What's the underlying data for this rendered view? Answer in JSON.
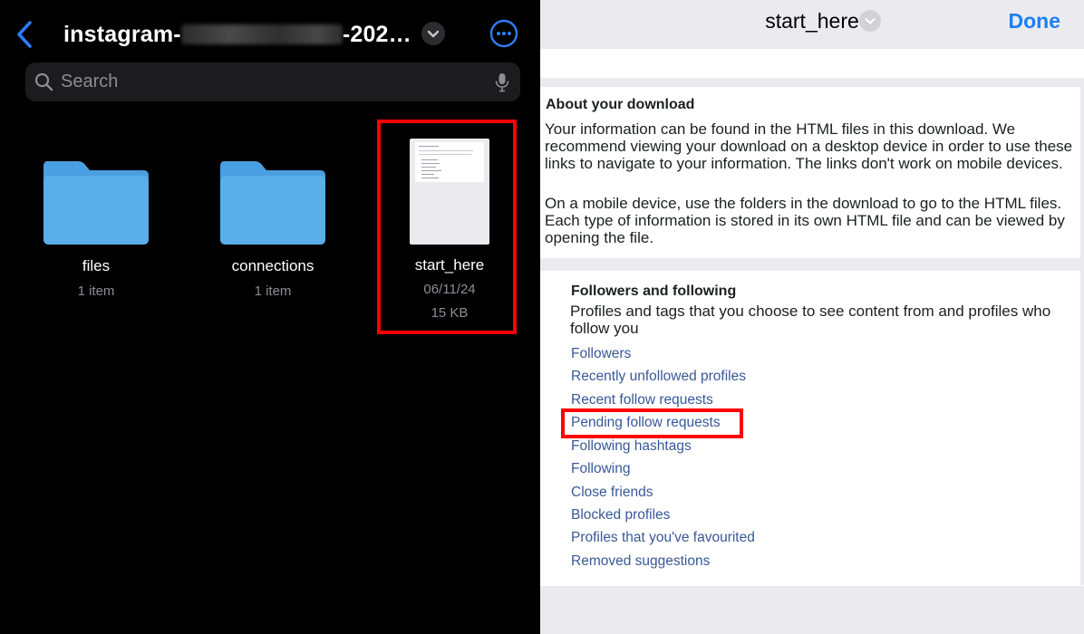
{
  "left": {
    "title_prefix": "instagram-",
    "title_suffix": "-202…",
    "search": {
      "placeholder": "Search"
    },
    "items": [
      {
        "name": "files",
        "meta": "1 item"
      },
      {
        "name": "connections",
        "meta": "1 item"
      },
      {
        "name": "start_here",
        "date": "06/11/24",
        "size": "15 KB"
      }
    ],
    "colors": {
      "accent": "#2f7bf6",
      "folder": "#5aaee9"
    }
  },
  "right": {
    "title": "start_here",
    "done_label": "Done",
    "about": {
      "heading": "About your download",
      "para1": "Your information can be found in the HTML files in this download. We recommend viewing your download on a desktop device in order to use these links to navigate to your information. The links don't work on mobile devices.",
      "para2": "On a mobile device, use the folders in the download to go to the HTML files. Each type of information is stored in its own HTML file and can be viewed by opening the file."
    },
    "followers": {
      "heading": "Followers and following",
      "description": "Profiles and tags that you choose to see content from and profiles who follow you",
      "links": [
        "Followers",
        "Recently unfollowed profiles",
        "Recent follow requests",
        "Pending follow requests",
        "Following hashtags",
        "Following",
        "Close friends",
        "Blocked profiles",
        "Profiles that you've favourited",
        "Removed suggestions"
      ]
    },
    "colors": {
      "link": "#385898",
      "done": "#1b7ff2",
      "highlight": "#ff0000"
    }
  }
}
